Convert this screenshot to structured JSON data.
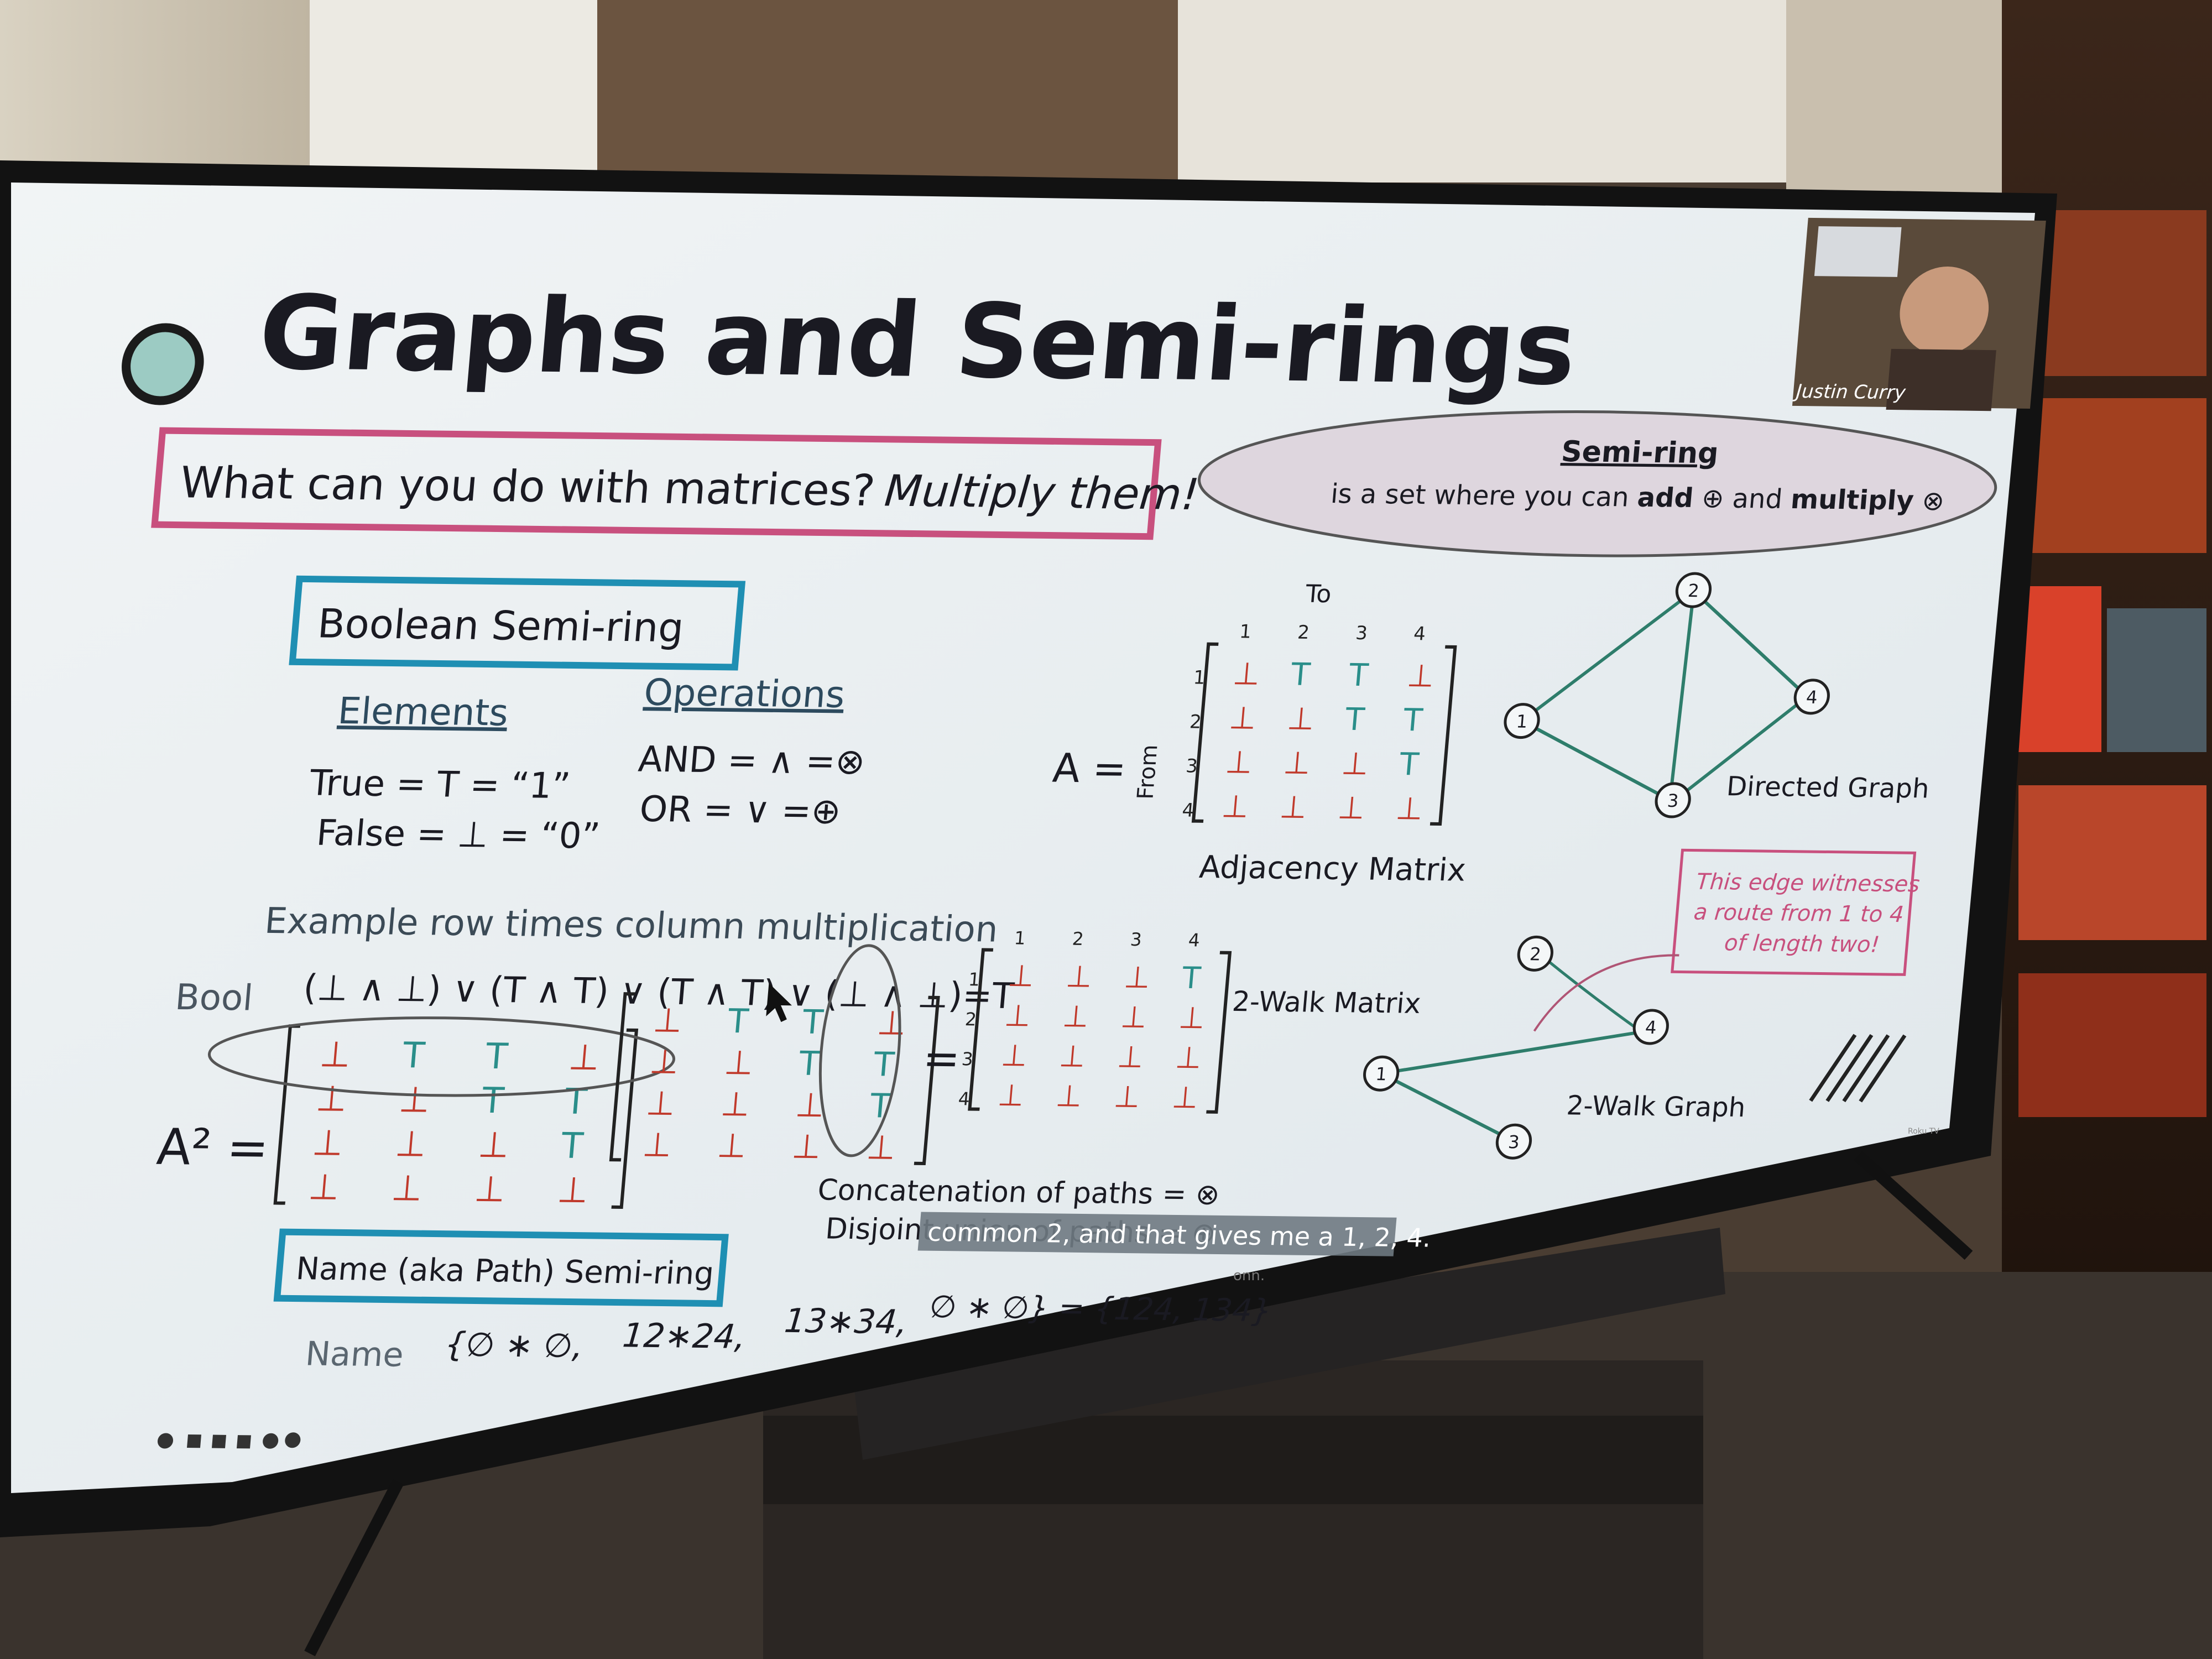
{
  "slide": {
    "title": "Graphs and Semi-rings",
    "question": "What can you do with matrices?",
    "question_emphasis": "Multiply them!",
    "semiring_cloud": {
      "heading": "Semi-ring",
      "text_prefix": "is a set where you can",
      "add_word": "add",
      "add_symbol": "⊕",
      "and_word": "and",
      "multiply_word": "multiply",
      "multiply_symbol": "⊗"
    },
    "boolean": {
      "box_title": "Boolean Semi-ring",
      "elements_heading": "Elements",
      "operations_heading": "Operations",
      "true_line": "True = T = “1”",
      "false_line": "False = ⊥ = “0”",
      "and_line": "AND = ∧ =⊗",
      "or_line": "OR = ∨ =⊕"
    },
    "adjacency": {
      "to_label": "To",
      "from_label": "From",
      "a_label": "A =",
      "caption": "Adjacency Matrix",
      "col_labels": [
        "1",
        "2",
        "3",
        "4"
      ],
      "row_labels": [
        "1",
        "2",
        "3",
        "4"
      ],
      "rows": [
        [
          "⊥",
          "T",
          "T",
          "⊥"
        ],
        [
          "⊥",
          "⊥",
          "T",
          "T"
        ],
        [
          "⊥",
          "⊥",
          "⊥",
          "T"
        ],
        [
          "⊥",
          "⊥",
          "⊥",
          "⊥"
        ]
      ]
    },
    "directed_graph": {
      "caption": "Directed Graph",
      "nodes": [
        "1",
        "2",
        "3",
        "4"
      ]
    },
    "example": {
      "heading": "Example row times column multiplication",
      "bool_label": "Bool",
      "expression": "(⊥ ∧ ⊥) ∨ (T ∧ T) ∨ (T ∧ T) ∨ (⊥ ∧ ⊥)=T"
    },
    "squared": {
      "label": "A² =",
      "left_rows": [
        [
          "⊥",
          "T",
          "T",
          "⊥"
        ],
        [
          "⊥",
          "⊥",
          "T",
          "T"
        ],
        [
          "⊥",
          "⊥",
          "⊥",
          "T"
        ],
        [
          "⊥",
          "⊥",
          "⊥",
          "⊥"
        ]
      ],
      "right_rows": [
        [
          "⊥",
          "T",
          "T",
          "⊥"
        ],
        [
          "⊥",
          "⊥",
          "T",
          "T"
        ],
        [
          "⊥",
          "⊥",
          "⊥",
          "T"
        ],
        [
          "⊥",
          "⊥",
          "⊥",
          "⊥"
        ]
      ],
      "equals": "="
    },
    "two_walk": {
      "caption": "2-Walk Matrix",
      "col_labels": [
        "1",
        "2",
        "3",
        "4"
      ],
      "row_labels": [
        "1",
        "2",
        "3",
        "4"
      ],
      "rows": [
        [
          "⊥",
          "⊥",
          "⊥",
          "T"
        ],
        [
          "⊥",
          "⊥",
          "⊥",
          "⊥"
        ],
        [
          "⊥",
          "⊥",
          "⊥",
          "⊥"
        ],
        [
          "⊥",
          "⊥",
          "⊥",
          "⊥"
        ]
      ],
      "graph_caption": "2-Walk Graph",
      "note_line1": "This edge witnesses",
      "note_line2": "a route from 1 to 4",
      "note_line3": "of length two!"
    },
    "path_notes": {
      "concat": "Concatenation of paths = ⊗",
      "union": "Disjoint union of paths = ⊕"
    },
    "name_semiring": {
      "box_title": "Name (aka Path) Semi-ring",
      "name_label": "Name",
      "terms": [
        "{∅ ∗ ∅,",
        "12∗24,",
        "13∗34,",
        "∅ ∗ ∅} = {124, 134}"
      ]
    },
    "caption_overlay": "common 2, and that gives me a 1, 2, 4.",
    "presenter": "Justin Curry"
  },
  "tv": {
    "brand": "onn.",
    "badge": "Roku TV"
  },
  "colors": {
    "slide_bg": "#e9eef0",
    "title_circle": "#9ccbc3",
    "pink_box": "#c8507e",
    "teal_box": "#1f8fb3",
    "bottom_red": "#c0392b",
    "top_teal": "#2a8e8a",
    "graph_edge": "#2e7d6b"
  }
}
